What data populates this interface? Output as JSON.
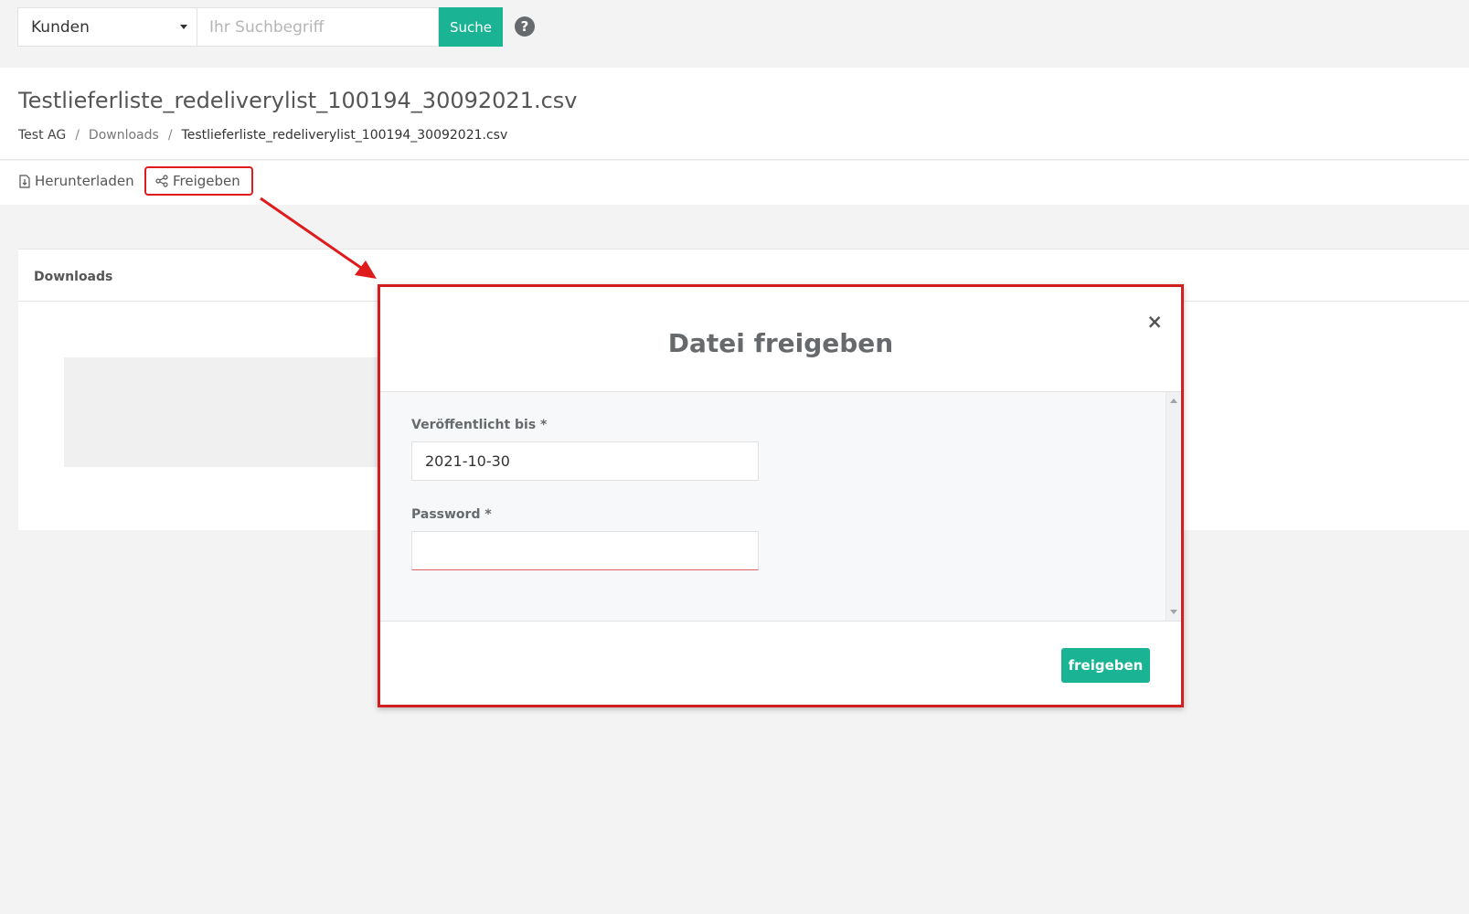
{
  "search": {
    "category": "Kunden",
    "placeholder": "Ihr Suchbegriff",
    "value": "",
    "button_label": "Suche",
    "help_glyph": "?"
  },
  "page": {
    "title": "Testlieferliste_redeliverylist_100194_30092021.csv",
    "breadcrumb": {
      "root": "Test AG",
      "separator": "/",
      "parent": "Downloads",
      "current": "Testlieferliste_redeliverylist_100194_30092021.csv"
    }
  },
  "toolbar": {
    "download_label": "Herunterladen",
    "share_label": "Freigeben"
  },
  "panel": {
    "title": "Downloads"
  },
  "modal": {
    "close_glyph": "×",
    "title": "Datei freigeben",
    "fields": {
      "published_until": {
        "label": "Veröffentlicht bis *",
        "value": "2021-10-30"
      },
      "password": {
        "label": "Password *",
        "value": ""
      }
    },
    "submit_label": "freigeben"
  },
  "colors": {
    "accent": "#1ab394",
    "annotation": "#e01b1b",
    "background": "#f3f3f3"
  },
  "icons": {
    "download": "file-download-icon",
    "share": "share-icon",
    "help": "help-circle-icon",
    "caret": "caret-down-icon"
  }
}
